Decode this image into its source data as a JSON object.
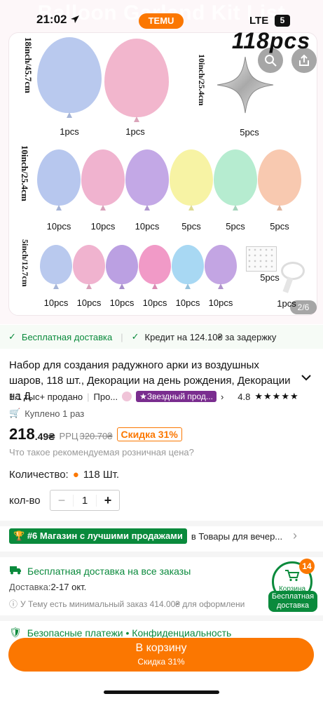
{
  "status_bar": {
    "time": "21:02",
    "network": "LTE",
    "battery": "5",
    "app_badge": "TEMU"
  },
  "hero": {
    "banner_title": "Balloon Garland Kit List",
    "title": "118pcs",
    "pager": "2/6",
    "rows": [
      {
        "size_label": "18inch/45.7cm",
        "items": [
          {
            "color": "#b9c9ee",
            "qty": "1pcs"
          },
          {
            "color": "#f2b6cd",
            "qty": "1pcs"
          }
        ],
        "extra": {
          "size_label": "10inch/25.4cm",
          "qty": "5pcs"
        }
      },
      {
        "size_label": "10inch/25.4cm",
        "items": [
          {
            "color": "#b7c7ee",
            "qty": "10pcs"
          },
          {
            "color": "#f0b3cf",
            "qty": "10pcs"
          },
          {
            "color": "#c3a8e6",
            "qty": "10pcs"
          },
          {
            "color": "#f7f3a4",
            "qty": "5pcs"
          },
          {
            "color": "#b6ecd0",
            "qty": "5pcs"
          },
          {
            "color": "#f8c9b0",
            "qty": "5pcs"
          }
        ]
      },
      {
        "size_label": "5inch/12.7cm",
        "items": [
          {
            "color": "#b9c9ee",
            "qty": "10pcs"
          },
          {
            "color": "#f0b3cf",
            "qty": "10pcs"
          },
          {
            "color": "#bba0e2",
            "qty": "10pcs"
          },
          {
            "color": "#f19ac7",
            "qty": "10pcs"
          },
          {
            "color": "#a8d8f3",
            "qty": "10pcs"
          },
          {
            "color": "#c3a5e3",
            "qty": "10pcs"
          }
        ],
        "extras": [
          {
            "qty": "5pcs"
          },
          {
            "qty": "1pcs"
          }
        ]
      }
    ]
  },
  "shipping_bar": {
    "free": "Бесплатная доставка",
    "credit": "Кредит на 124.10₴ за задержку"
  },
  "product": {
    "title": "Набор для создания радужного арки из воздушных шаров, 118 шт., Декорации на день рождения, Декорации на Д",
    "sold": "1.1 тыс+ продано",
    "seller": "Про...",
    "star_badge": "Звездный прод...",
    "rating": "4.8",
    "stars": "★★★★★",
    "bought": "Куплено 1 раз",
    "price_main": "218",
    "price_frac": ".49₴",
    "rrp_label": "РРЦ",
    "rrp_value": "320.70₴",
    "discount": "Скидка 31%",
    "rrp_question": "Что такое рекомендуемая розничная цена?",
    "quantity_label": "Количество:",
    "quantity_value": "118 Шт.",
    "qty_label": "кол-во",
    "qty_value": "1"
  },
  "shop": {
    "rank_badge": "#6 Магазин с лучшими продажами",
    "category": "в Товары для вечер..."
  },
  "delivery": {
    "title": "Бесплатная доставка на все заказы",
    "time_label": "Доставка:",
    "time_value": "2-17 окт.",
    "note": "У Тему есть минимальный заказ 414.00₴ для оформлени"
  },
  "security": {
    "text": "Безопасные платежи • Конфиденциальность"
  },
  "cart_widget": {
    "count": "14",
    "label": "Корзина",
    "free_line1": "Бесплатная",
    "free_line2": "доставка"
  },
  "cart_button": {
    "label": "В корзину",
    "sub": "Скидка 31%"
  }
}
